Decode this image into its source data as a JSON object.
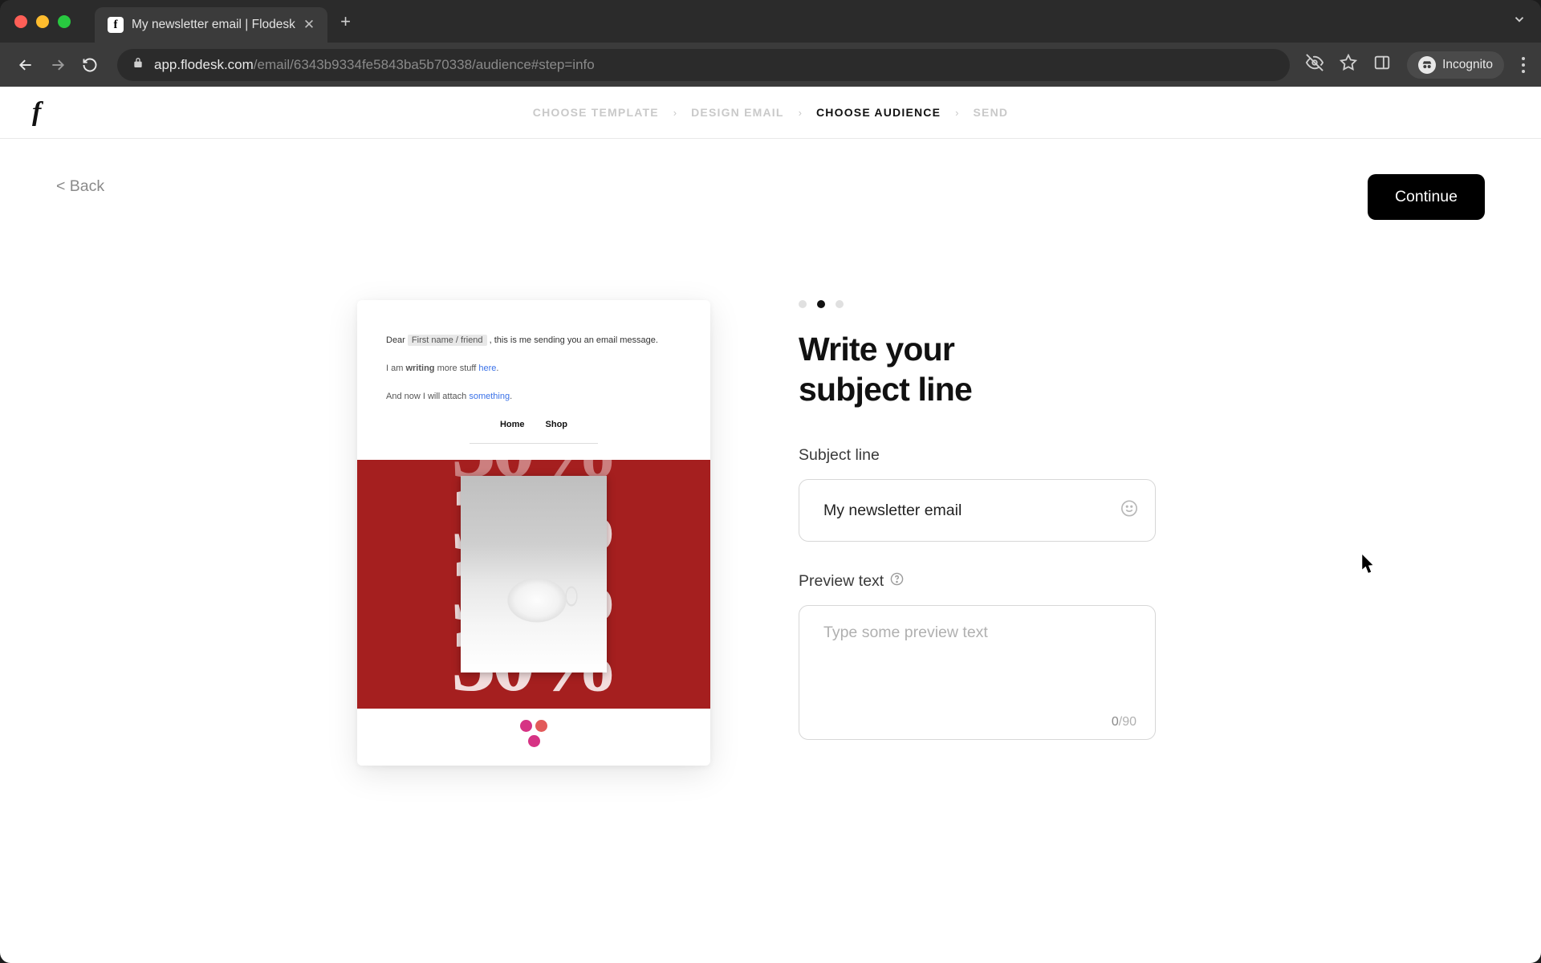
{
  "browser": {
    "tab_title": "My newsletter email | Flodesk",
    "url_host": "app.flodesk.com",
    "url_path": "/email/6343b9334fe5843ba5b70338/audience#step=info",
    "incognito_label": "Incognito"
  },
  "nav": {
    "steps": {
      "choose_template": "CHOOSE TEMPLATE",
      "design_email": "DESIGN EMAIL",
      "choose_audience": "CHOOSE AUDIENCE",
      "send": "SEND"
    }
  },
  "page": {
    "back": "< Back",
    "continue": "Continue",
    "heading_l1": "Write your",
    "heading_l2": "subject line",
    "subject_label": "Subject line",
    "subject_value": "My newsletter email",
    "preview_label": "Preview text",
    "preview_placeholder": "Type some preview text",
    "char_current": "0",
    "char_max": "/90"
  },
  "preview": {
    "greeting_pre": "Dear ",
    "greeting_token": "First name / friend",
    "greeting_post": " , this is me sending you an email message.",
    "line2_pre": "I am ",
    "line2_bold": "writing",
    "line2_mid": " more stuff ",
    "line2_link": "here",
    "line2_end": ".",
    "line3_pre": "And now I will attach ",
    "line3_link": "something",
    "line3_end": ".",
    "nav_home": "Home",
    "nav_shop": "Shop",
    "hero_pct": "30%"
  }
}
